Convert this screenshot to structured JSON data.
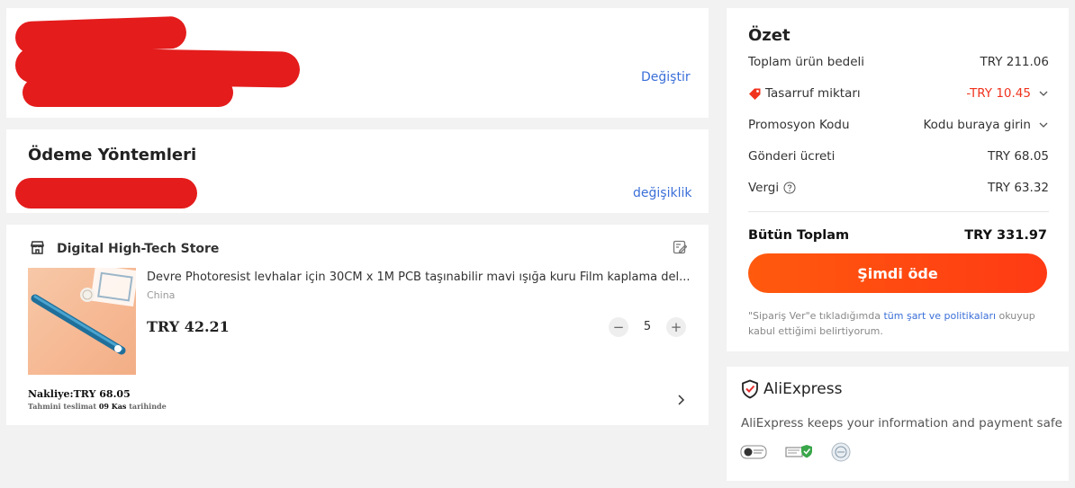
{
  "address": {
    "change_label": "Değiştir"
  },
  "payment": {
    "title": "Ödeme Yöntemleri",
    "change_label": "değişiklik"
  },
  "store": {
    "name": "Digital High-Tech Store",
    "product": {
      "title": "Devre Photoresist levhalar için 30CM x 1M PCB taşınabilir mavi ışığa kuru Film kaplama del...",
      "origin": "China",
      "price": "TRY 42.21",
      "quantity": "5"
    },
    "shipping": "Nakliye:TRY 68.05",
    "delivery_prefix": "Tahmini teslimat",
    "delivery_date": "09 Kas",
    "delivery_suffix": "tarihinde"
  },
  "summary": {
    "title": "Özet",
    "rows": [
      {
        "label": "Toplam ürün bedeli",
        "value": "TRY 211.06"
      },
      {
        "label": "Tasarruf miktarı",
        "value": "-TRY 10.45"
      },
      {
        "label": "Promosyon Kodu",
        "value": "Kodu buraya girin"
      },
      {
        "label": "Gönderi ücreti",
        "value": "TRY 68.05"
      },
      {
        "label": "Vergi",
        "value": "TRY 63.32"
      }
    ],
    "total_label": "Bütün Toplam",
    "total_value": "TRY 331.97",
    "pay_button": "Şimdi öde",
    "terms_before": "\"Sipariş Ver\"e tıkladığımda",
    "terms_link": "tüm şart ve politikaları",
    "terms_after": "okuyup kabul ettiğimi belirtiyorum."
  },
  "trust": {
    "brand": "AliExpress",
    "message": "AliExpress keeps your information and payment safe"
  },
  "colors": {
    "accent_link": "#3b6fd8",
    "discount_red": "#f0331d",
    "pay_button": "#ff4a12",
    "redaction": "#e41c1c"
  }
}
